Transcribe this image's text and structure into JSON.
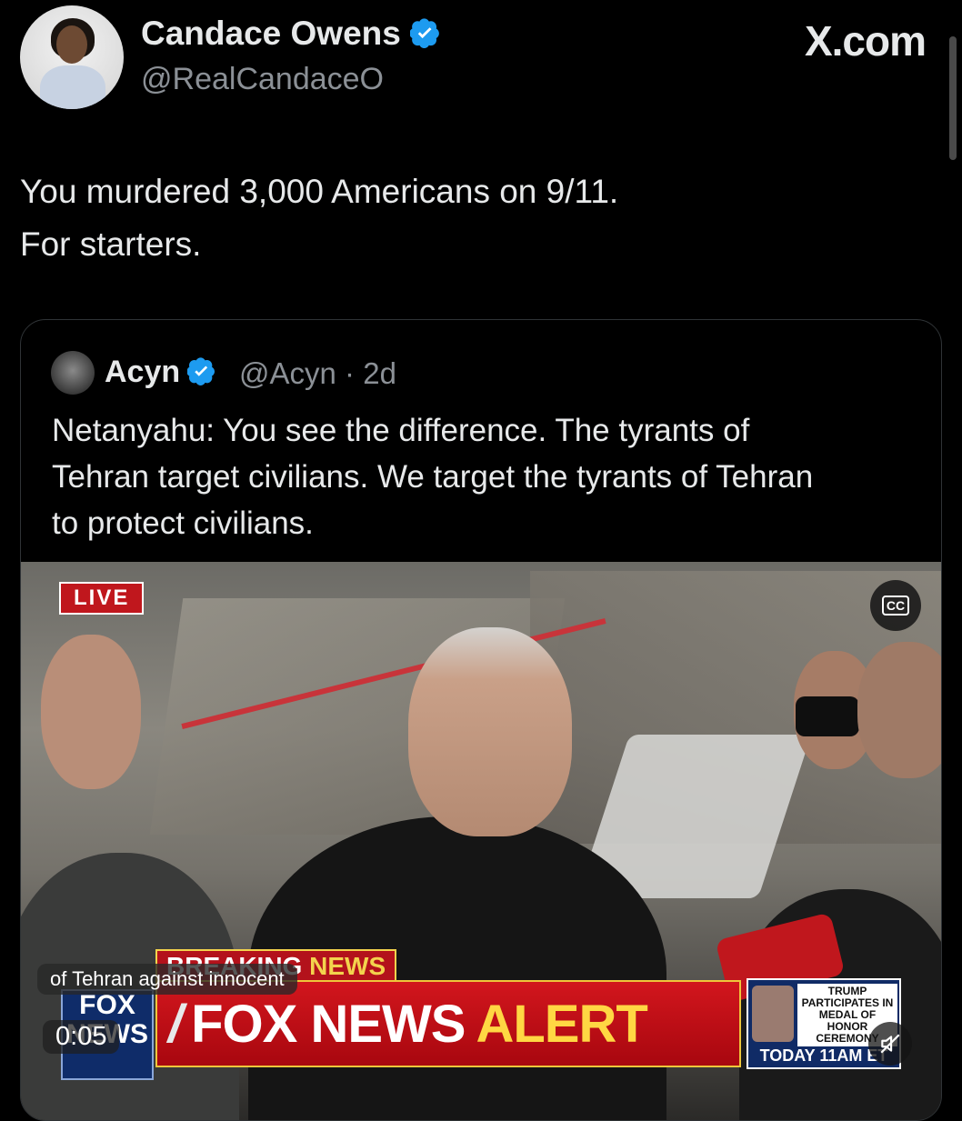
{
  "author": {
    "name": "Candace Owens",
    "handle": "@RealCandaceO"
  },
  "site": "X.com",
  "tweet": {
    "lines": [
      "You murdered 3,000 Americans on 9/11.",
      "For starters."
    ]
  },
  "quote": {
    "name": "Acyn",
    "handle": "@Acyn",
    "age": "2d",
    "text_lines": [
      "Netanyahu: You see the difference. The tyrants of",
      "Tehran target civilians. We target the tyrants of Tehran",
      "to protect civilians."
    ]
  },
  "video": {
    "live_badge": "LIVE",
    "cc_label": "CC",
    "breaking_prefix": "BREAKING",
    "breaking_suffix": "NEWS",
    "alert_prefix": "FOX NEWS",
    "alert_suffix": "ALERT",
    "logo_line1": "FOX",
    "logo_line2": "NEWS",
    "side_text": "TRUMP PARTICIPATES IN MEDAL OF HONOR CEREMONY",
    "side_time": "TODAY 11AM ET",
    "caption": "of Tehran against innocent",
    "timestamp": "0:05"
  },
  "colors": {
    "verified": "#1d9bf0",
    "background": "#000000",
    "text": "#e7e9ea",
    "muted": "#8b9096"
  },
  "icons": [
    "verified-badge-icon",
    "closed-captions-icon",
    "mute-icon"
  ]
}
